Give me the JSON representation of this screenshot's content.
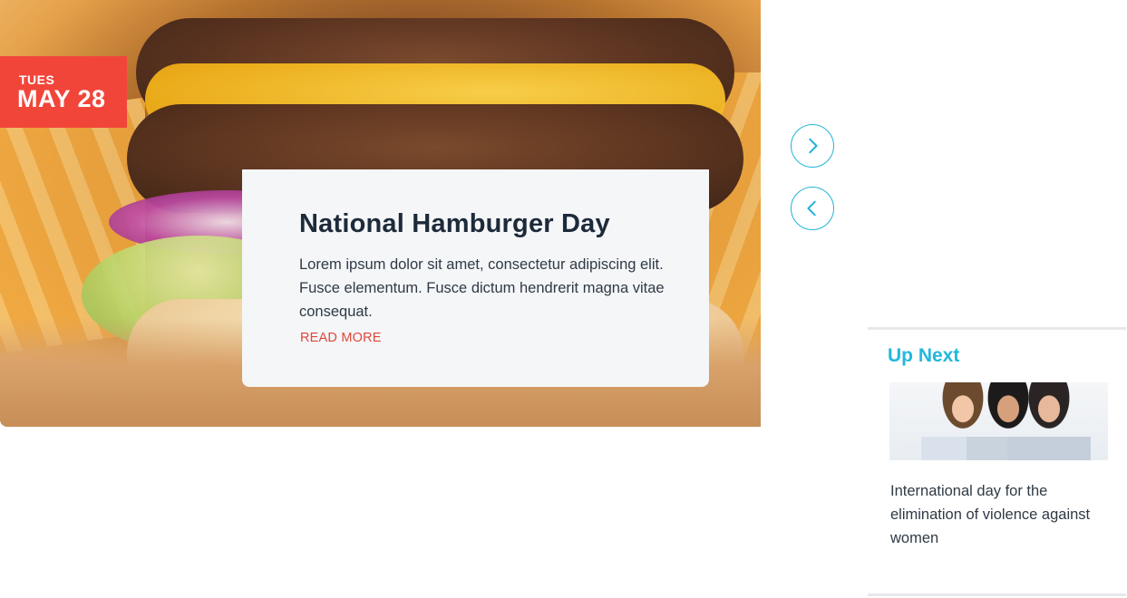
{
  "hero": {
    "date": {
      "dow": "TUES",
      "day": "MAY 28"
    },
    "card": {
      "title": "National Hamburger Day",
      "body": "Lorem ipsum dolor sit amet, consectetur adipiscing elit. Fusce elementum.  Fusce dictum hendrerit magna vitae consequat.",
      "read_more": "READ MORE"
    }
  },
  "nav": {
    "next_icon": "chevron-right-icon",
    "prev_icon": "chevron-left-icon",
    "accent": "#21b4d4"
  },
  "up_next": {
    "heading": "Up Next",
    "caption": "International day for the elimination of violence against women"
  },
  "colors": {
    "badge": "#f2453a",
    "link": "#e0473a",
    "heading_accent": "#22b8dc"
  }
}
